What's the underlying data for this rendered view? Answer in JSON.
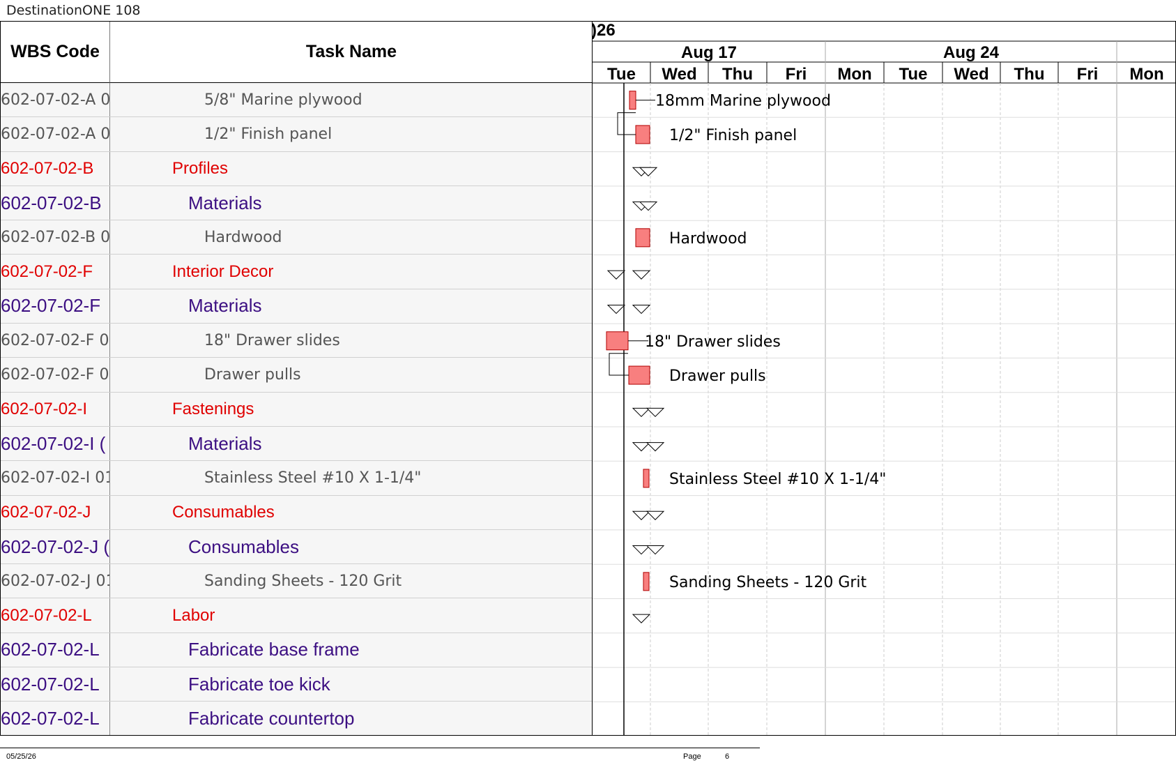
{
  "document": {
    "title": "DestinationONE 108"
  },
  "columns": {
    "wbs": "WBS Code",
    "task": "Task Name"
  },
  "timescale": {
    "year_fragment": ")26",
    "weeks": [
      "Aug 17",
      "Aug 24"
    ],
    "days": [
      "Tue",
      "Wed",
      "Thu",
      "Fri",
      "Mon",
      "Tue",
      "Wed",
      "Thu",
      "Fri",
      "Mon"
    ]
  },
  "rows": [
    {
      "wbs": "602-07-02-A 0",
      "task": "5/8\" Marine plywood",
      "level": 3,
      "bar_label": "18mm Marine plywood"
    },
    {
      "wbs": "602-07-02-A 0",
      "task": "1/2\" Finish panel",
      "level": 3,
      "bar_label": "1/2\" Finish panel"
    },
    {
      "wbs": "602-07-02-B",
      "task": "Profiles",
      "level": 1,
      "bar_label": ""
    },
    {
      "wbs": "602-07-02-B",
      "task": "Materials",
      "level": 2,
      "bar_label": ""
    },
    {
      "wbs": "602-07-02-B 0",
      "task": "Hardwood",
      "level": 3,
      "bar_label": "Hardwood"
    },
    {
      "wbs": "602-07-02-F",
      "task": "Interior Decor",
      "level": 1,
      "bar_label": ""
    },
    {
      "wbs": "602-07-02-F",
      "task": "Materials",
      "level": 2,
      "bar_label": ""
    },
    {
      "wbs": "602-07-02-F 0",
      "task": "18\" Drawer slides",
      "level": 3,
      "bar_label": "18\" Drawer slides"
    },
    {
      "wbs": "602-07-02-F 0",
      "task": "Drawer pulls",
      "level": 3,
      "bar_label": "Drawer pulls"
    },
    {
      "wbs": "602-07-02-I",
      "task": "Fastenings",
      "level": 1,
      "bar_label": ""
    },
    {
      "wbs": "602-07-02-I (",
      "task": "Materials",
      "level": 2,
      "bar_label": ""
    },
    {
      "wbs": "602-07-02-I 01",
      "task": "Stainless Steel #10 X 1-1/4\"",
      "level": 3,
      "bar_label": "Stainless Steel #10 X 1-1/4\""
    },
    {
      "wbs": "602-07-02-J",
      "task": "Consumables",
      "level": 1,
      "bar_label": ""
    },
    {
      "wbs": "602-07-02-J (",
      "task": "Consumables",
      "level": 2,
      "bar_label": ""
    },
    {
      "wbs": "602-07-02-J 01",
      "task": "Sanding Sheets - 120 Grit",
      "level": 3,
      "bar_label": "Sanding Sheets - 120 Grit"
    },
    {
      "wbs": "602-07-02-L",
      "task": "Labor",
      "level": 1,
      "bar_label": ""
    },
    {
      "wbs": "602-07-02-L",
      "task": "Fabricate base frame",
      "level": 2,
      "bar_label": ""
    },
    {
      "wbs": "602-07-02-L",
      "task": "Fabricate toe kick",
      "level": 2,
      "bar_label": ""
    },
    {
      "wbs": "602-07-02-L",
      "task": "Fabricate countertop",
      "level": 2,
      "bar_label": ""
    }
  ],
  "colors": {
    "level1": "#e00000",
    "level2": "#3c0f82",
    "level3": "#555555",
    "bar_fill": "#f87f7f"
  },
  "footer": {
    "date": "05/25/26",
    "page_label": "Page",
    "page_number": "6"
  }
}
